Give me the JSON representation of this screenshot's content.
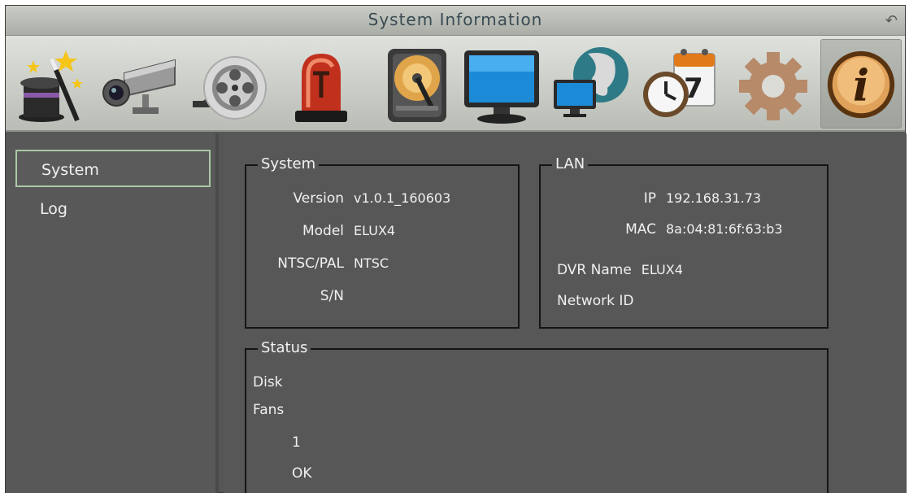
{
  "window": {
    "title": "System Information"
  },
  "toolbar": {
    "items": [
      {
        "name": "wizard"
      },
      {
        "name": "camera"
      },
      {
        "name": "record"
      },
      {
        "name": "alarm"
      },
      {
        "name": "disk"
      },
      {
        "name": "display"
      },
      {
        "name": "network"
      },
      {
        "name": "schedule",
        "day": "7"
      },
      {
        "name": "settings"
      },
      {
        "name": "info",
        "glyph": "i",
        "active": true
      }
    ]
  },
  "sidebar": {
    "items": [
      {
        "label": "System",
        "selected": true
      },
      {
        "label": "Log"
      }
    ]
  },
  "system_group": {
    "title": "System",
    "fields": [
      {
        "label": "Version",
        "value": "v1.0.1_160603"
      },
      {
        "label": "Model",
        "value": "ELUX4"
      },
      {
        "label": "NTSC/PAL",
        "value": "NTSC"
      },
      {
        "label": "S/N",
        "value": ""
      }
    ]
  },
  "lan_group": {
    "title": "LAN",
    "fields": [
      {
        "label": "IP",
        "value": "192.168.31.73"
      },
      {
        "label": "MAC",
        "value": "8a:04:81:6f:63:b3"
      },
      {
        "label": "DVR Name",
        "value": "ELUX4"
      },
      {
        "label": "Network ID",
        "value": ""
      }
    ]
  },
  "status_group": {
    "title": "Status",
    "disk_label": "Disk",
    "fans_label": "Fans",
    "fan_number": "1",
    "fan_status": "OK"
  },
  "colors": {
    "selected_border": "#a9c9a4",
    "panel_bg": "#575757",
    "toolbar_bg": "#c9cdc6"
  }
}
